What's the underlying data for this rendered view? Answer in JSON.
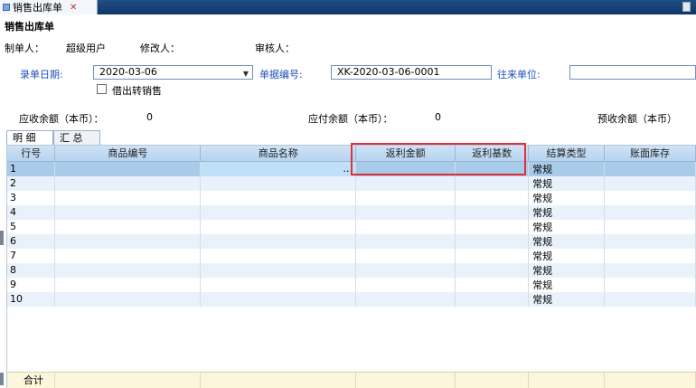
{
  "tab": {
    "title": "销售出库单",
    "close": "✕"
  },
  "form": {
    "title": "销售出库单",
    "creator_label": "制单人：",
    "creator_value": "超级用户",
    "modifier_label": "修改人：",
    "reviewer_label": "审核人："
  },
  "fields": {
    "date_label": "录单日期:",
    "date_value": "2020-03-06",
    "doc_no_label": "单据编号:",
    "doc_no_value": "XK-2020-03-06-0001",
    "partner_label": "往来单位:",
    "partner_value": "",
    "borrow_label": "借出转销售"
  },
  "summary": {
    "receivable_label": "应收余额（本币）：",
    "receivable_value": "0",
    "payable_label": "应付余额（本币）：",
    "payable_value": "0",
    "prereceive_label": "预收余额（本币）"
  },
  "grid_tabs": [
    "明 细",
    "汇 总"
  ],
  "grid": {
    "columns": [
      "行号",
      "商品编号",
      "商品名称",
      "返利金额",
      "返利基数",
      "结算类型",
      "账面库存"
    ],
    "rows": [
      [
        "1",
        "",
        "…",
        "",
        "",
        "常规",
        ""
      ],
      [
        "2",
        "",
        "",
        "",
        "",
        "常规",
        ""
      ],
      [
        "3",
        "",
        "",
        "",
        "",
        "常规",
        ""
      ],
      [
        "4",
        "",
        "",
        "",
        "",
        "常规",
        ""
      ],
      [
        "5",
        "",
        "",
        "",
        "",
        "常规",
        ""
      ],
      [
        "6",
        "",
        "",
        "",
        "",
        "常规",
        ""
      ],
      [
        "7",
        "",
        "",
        "",
        "",
        "常规",
        ""
      ],
      [
        "8",
        "",
        "",
        "",
        "",
        "常规",
        ""
      ],
      [
        "9",
        "",
        "",
        "",
        "",
        "常规",
        ""
      ],
      [
        "10",
        "",
        "",
        "",
        "",
        "常规",
        ""
      ]
    ],
    "total_label": "合计"
  }
}
